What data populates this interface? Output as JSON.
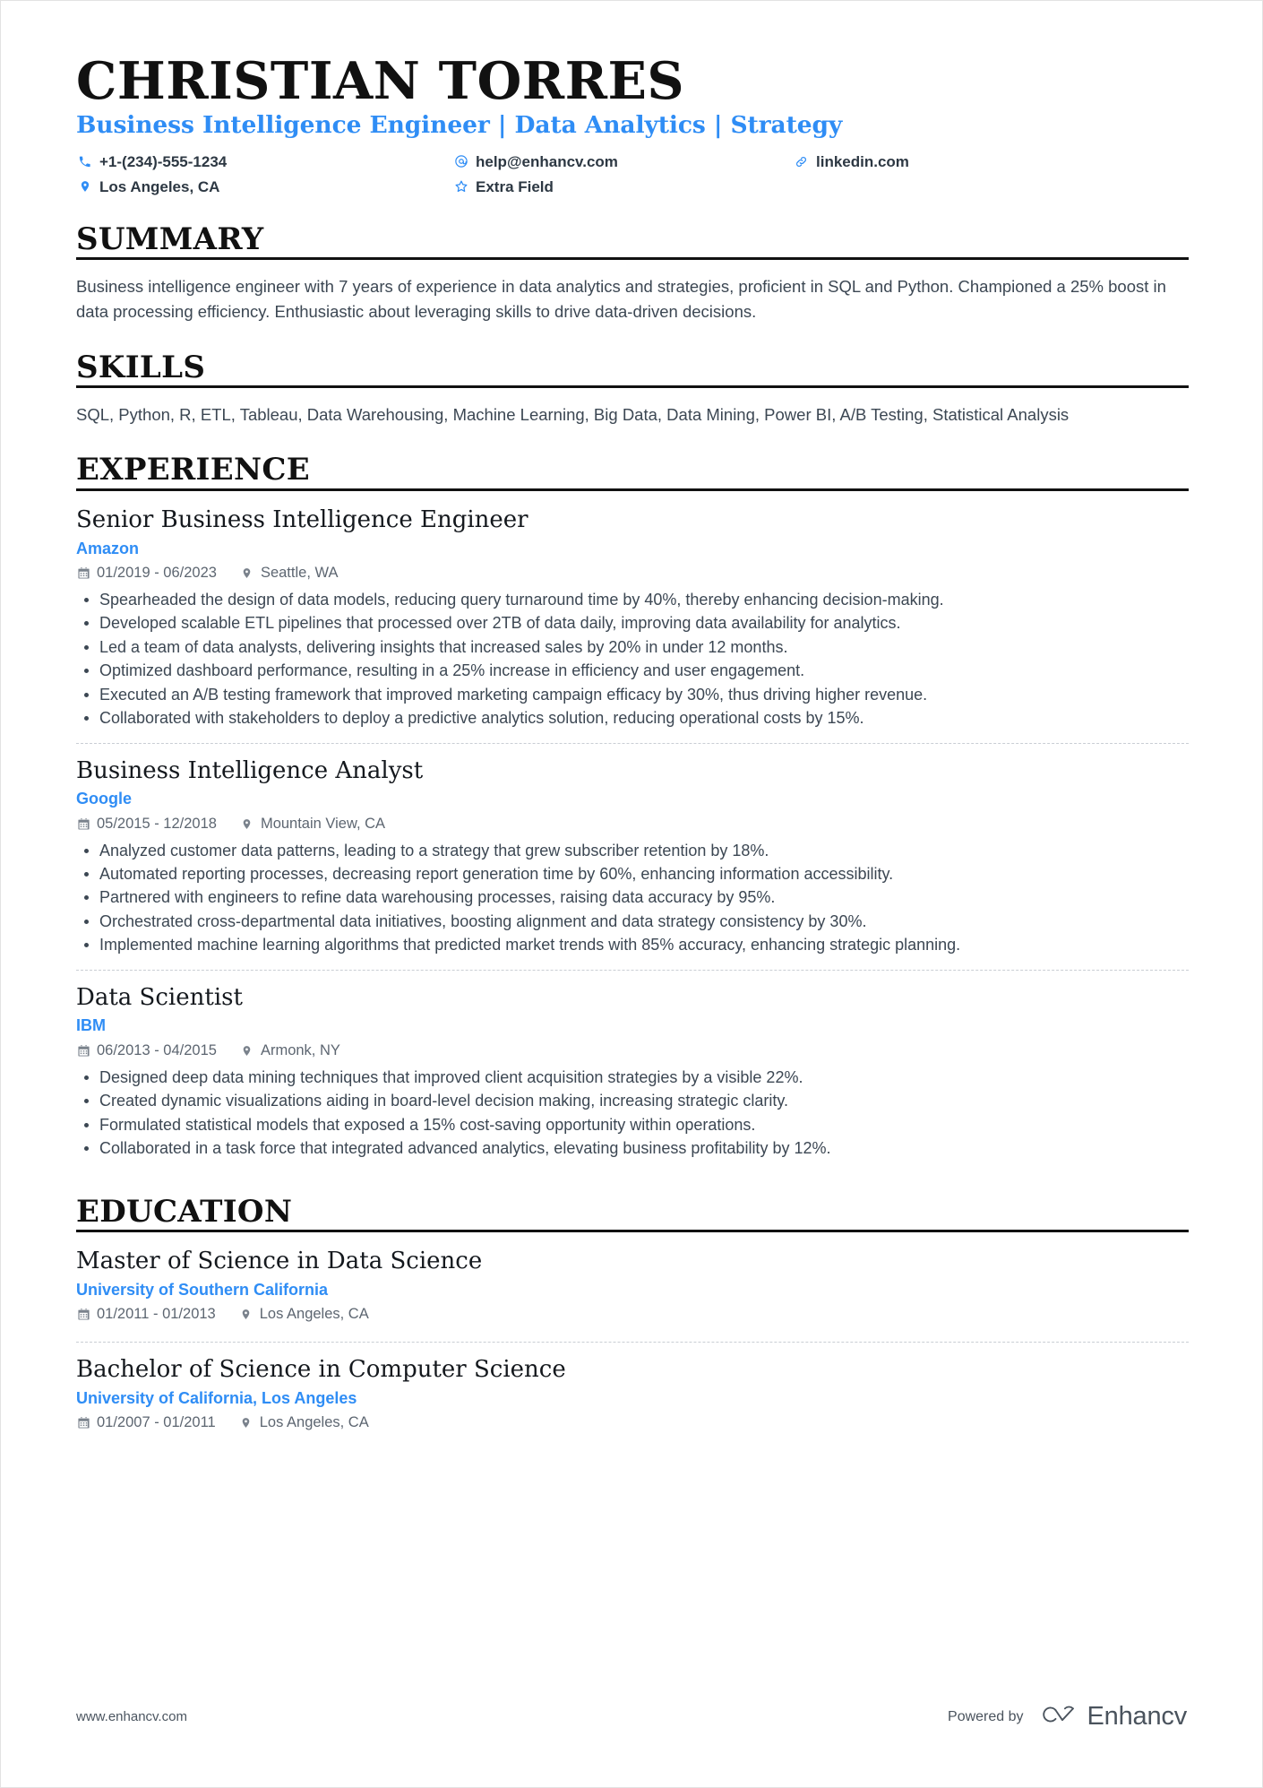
{
  "header": {
    "name": "CHRISTIAN TORRES",
    "headline": "Business Intelligence Engineer | Data Analytics | Strategy",
    "contacts": [
      {
        "icon": "phone-icon",
        "text": "+1-(234)-555-1234"
      },
      {
        "icon": "email-icon",
        "text": "help@enhancv.com"
      },
      {
        "icon": "link-icon",
        "text": "linkedin.com"
      },
      {
        "icon": "location-icon",
        "text": "Los Angeles, CA"
      },
      {
        "icon": "star-icon",
        "text": "Extra Field"
      }
    ]
  },
  "sections": {
    "summary": {
      "heading": "SUMMARY",
      "text": "Business intelligence engineer with 7 years of experience in data analytics and strategies, proficient in SQL and Python. Championed a 25% boost in data processing efficiency. Enthusiastic about leveraging skills to drive data-driven decisions."
    },
    "skills": {
      "heading": "SKILLS",
      "text": "SQL, Python, R, ETL, Tableau, Data Warehousing, Machine Learning, Big Data, Data Mining, Power BI, A/B Testing, Statistical Analysis"
    },
    "experience": {
      "heading": "EXPERIENCE",
      "entries": [
        {
          "title": "Senior Business Intelligence Engineer",
          "org": "Amazon",
          "dates": "01/2019 - 06/2023",
          "location": "Seattle, WA",
          "bullets": [
            "Spearheaded the design of data models, reducing query turnaround time by 40%, thereby enhancing decision-making.",
            "Developed scalable ETL pipelines that processed over 2TB of data daily, improving data availability for analytics.",
            "Led a team of data analysts, delivering insights that increased sales by 20% in under 12 months.",
            "Optimized dashboard performance, resulting in a 25% increase in efficiency and user engagement.",
            "Executed an A/B testing framework that improved marketing campaign efficacy by 30%, thus driving higher revenue.",
            "Collaborated with stakeholders to deploy a predictive analytics solution, reducing operational costs by 15%."
          ]
        },
        {
          "title": "Business Intelligence Analyst",
          "org": "Google",
          "dates": "05/2015 - 12/2018",
          "location": "Mountain View, CA",
          "bullets": [
            "Analyzed customer data patterns, leading to a strategy that grew subscriber retention by 18%.",
            "Automated reporting processes, decreasing report generation time by 60%, enhancing information accessibility.",
            "Partnered with engineers to refine data warehousing processes, raising data accuracy by 95%.",
            "Orchestrated cross-departmental data initiatives, boosting alignment and data strategy consistency by 30%.",
            "Implemented machine learning algorithms that predicted market trends with 85% accuracy, enhancing strategic planning."
          ]
        },
        {
          "title": "Data Scientist",
          "org": "IBM",
          "dates": "06/2013 - 04/2015",
          "location": "Armonk, NY",
          "bullets": [
            "Designed deep data mining techniques that improved client acquisition strategies by a visible 22%.",
            "Created dynamic visualizations aiding in board-level decision making, increasing strategic clarity.",
            "Formulated statistical models that exposed a 15% cost-saving opportunity within operations.",
            "Collaborated in a task force that integrated advanced analytics, elevating business profitability by 12%."
          ]
        }
      ]
    },
    "education": {
      "heading": "EDUCATION",
      "entries": [
        {
          "title": "Master of Science in Data Science",
          "org": "University of Southern California",
          "dates": "01/2011 - 01/2013",
          "location": "Los Angeles, CA"
        },
        {
          "title": "Bachelor of Science in Computer Science",
          "org": "University of California, Los Angeles",
          "dates": "01/2007 - 01/2011",
          "location": "Los Angeles, CA"
        }
      ]
    }
  },
  "footer": {
    "url": "www.enhancv.com",
    "powered_by": "Powered by",
    "brand": "Enhancv"
  },
  "colors": {
    "accent": "#2f8df5",
    "text": "#3c4753",
    "heading": "#111111",
    "muted": "#5d6671"
  }
}
